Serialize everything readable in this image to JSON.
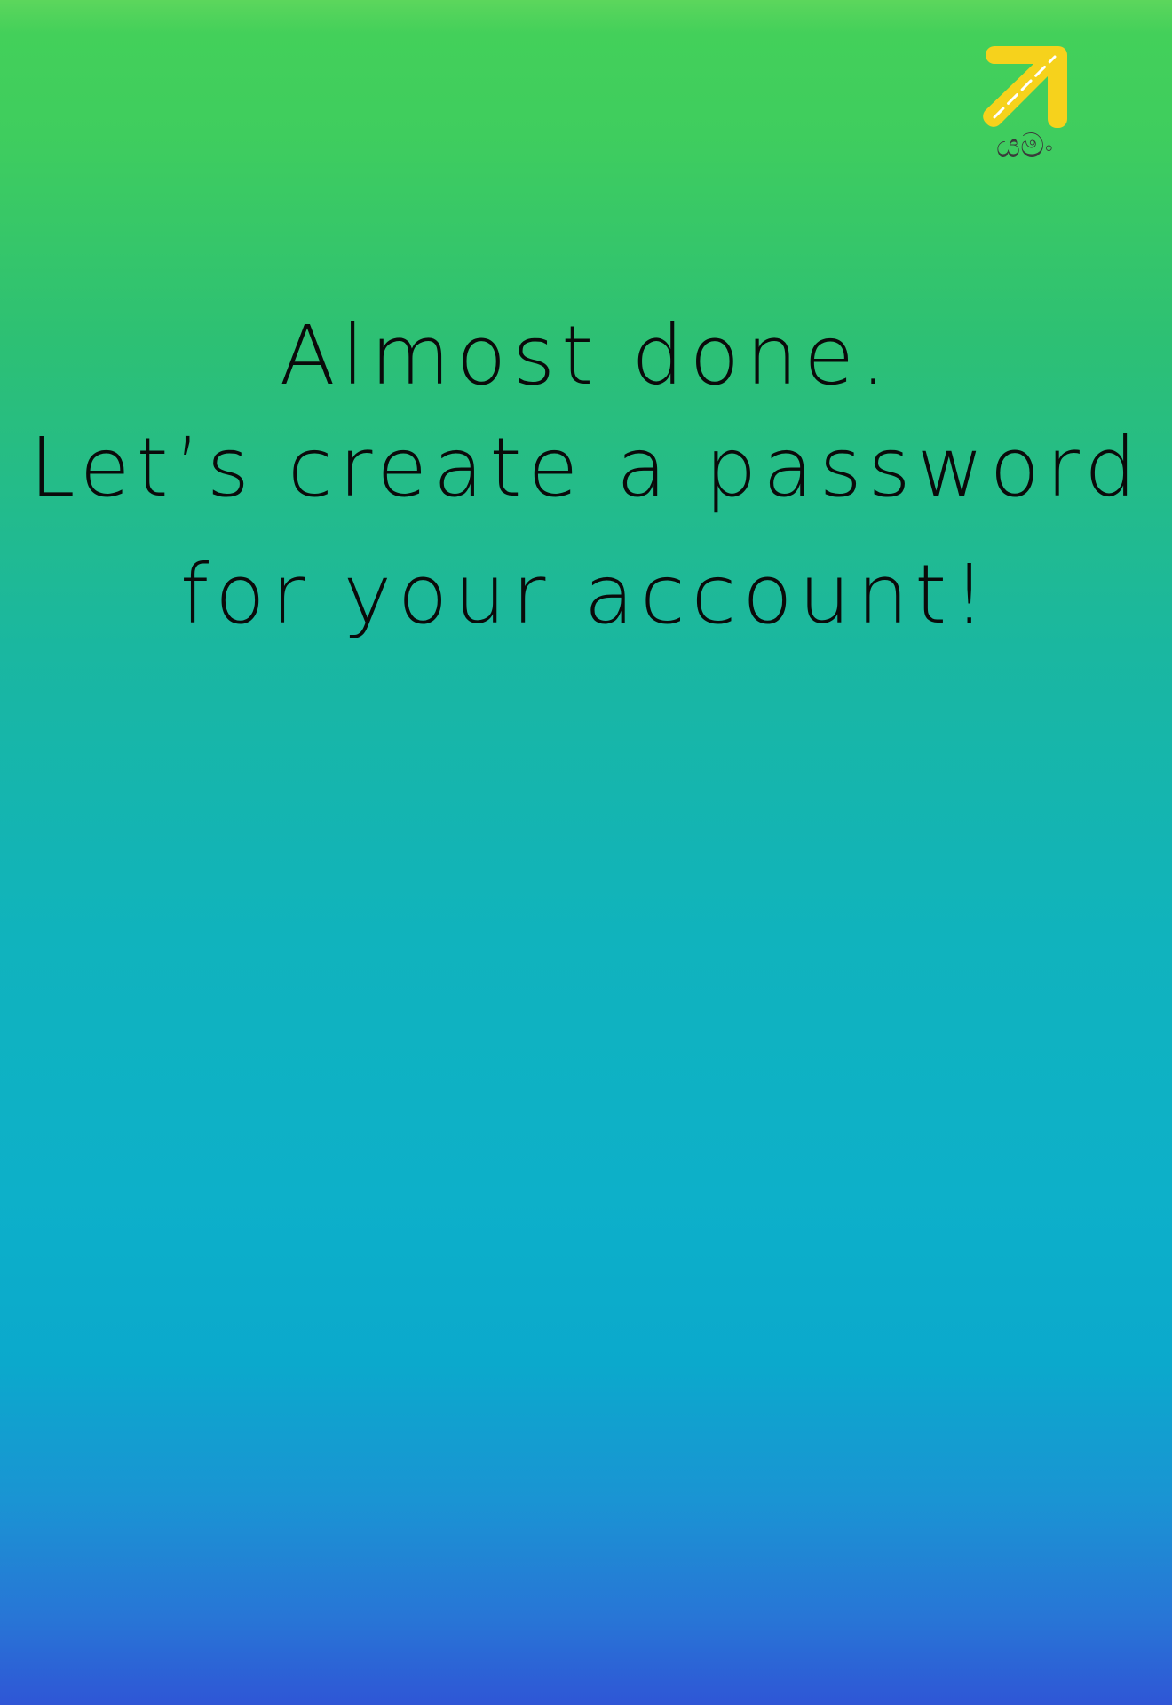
{
  "logo": {
    "icon": "arrow-up-right-icon",
    "wordmark": "යමං",
    "color": "#f6d21c"
  },
  "headline": {
    "line1": "Almost done.",
    "line2": "Let’s create a password",
    "line3": "for your account!"
  },
  "colors": {
    "gradient_top": "#43d05a",
    "gradient_mid": "#0db0c9",
    "gradient_bottom": "#2f56d6",
    "text": "#0a0a0a"
  }
}
